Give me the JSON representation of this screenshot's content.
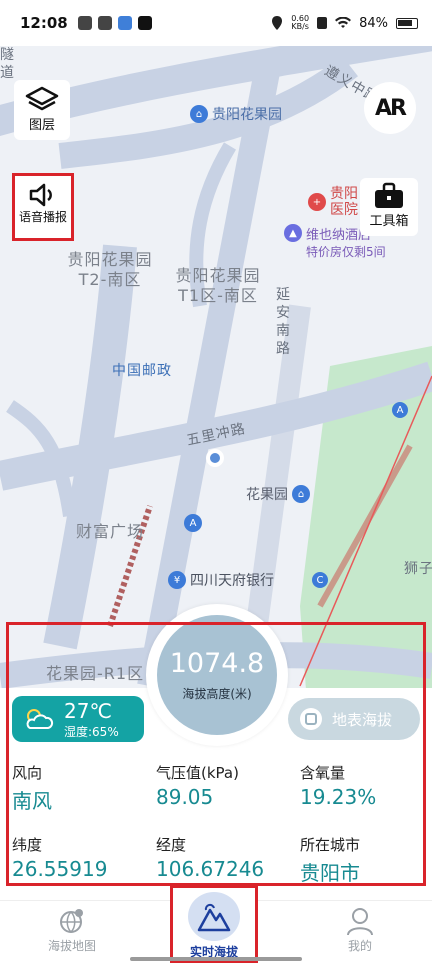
{
  "status_bar": {
    "time": "12:08",
    "net_speed_value": "0.60",
    "net_speed_unit": "KB/s",
    "battery": "84%"
  },
  "map": {
    "labels": {
      "tunnel": "隧道",
      "zunyi_road": "遵义中路",
      "park_poi": "贵阳花果园",
      "hospital": "贵阳医院",
      "hotel": "维也纳酒店",
      "hotel_promo": "特价房仅剩5间",
      "t2_south": "贵阳花果园 T2-南区",
      "t1_south": "贵阳花果园 T1区-南区",
      "yanan_road": "延安南路",
      "post": "中国邮政",
      "wuli_road": "五里冲路",
      "hgy_poi": "花果园",
      "wealth_plaza": "财富广场",
      "bank": "四川天府银行",
      "r1": "花果园-R1区",
      "shizi": "狮子"
    }
  },
  "buttons": {
    "layers": "图层",
    "voice": "语音播报",
    "ar": "AR",
    "toolbox": "工具箱",
    "terrain": "地表海拔"
  },
  "gauge": {
    "value": "1074.8",
    "label": "海拔高度(米)"
  },
  "weather": {
    "temp": "27℃",
    "humidity": "湿度:65%"
  },
  "readings": [
    {
      "label": "风向",
      "value": "南风"
    },
    {
      "label": "气压值(kPa)",
      "value": "89.05"
    },
    {
      "label": "含氧量",
      "value": "19.23%"
    },
    {
      "label": "纬度",
      "value": "26.55919"
    },
    {
      "label": "经度",
      "value": "106.67246"
    },
    {
      "label": "所在城市",
      "value": "贵阳市"
    }
  ],
  "tabs": [
    {
      "label": "海拔地图",
      "icon": "globe-pin-icon"
    },
    {
      "label": "实时海拔",
      "icon": "mountain-icon"
    },
    {
      "label": "我的",
      "icon": "person-icon"
    }
  ],
  "colors": {
    "accent_teal": "#14a3a4",
    "highlight_red": "#d9232a",
    "gauge_blue": "#a8c2d3",
    "tab_active": "#1d3f9e"
  }
}
